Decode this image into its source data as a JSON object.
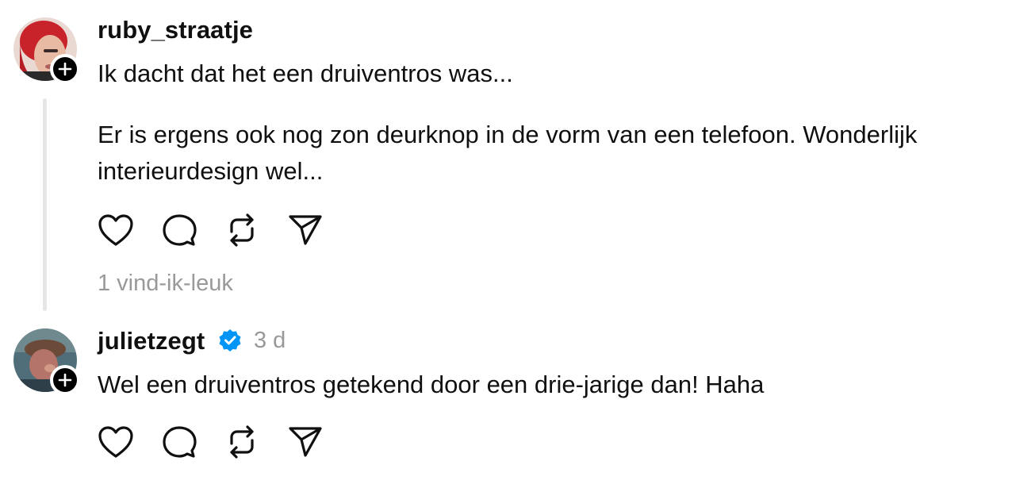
{
  "comments": [
    {
      "username": "ruby_straatje",
      "text_line1": "Ik dacht dat het een druiventros was...",
      "text_line2": "Er is ergens ook nog zon deurknop in de vorm van een telefoon. Wonderlijk",
      "text_line3": "interieurdesign wel...",
      "likes": "1 vind-ik-leuk",
      "avatar_icon": "avatar-red-hair",
      "follow_icon": "plus-icon"
    },
    {
      "username": "julietzegt",
      "verified": true,
      "time": "3 d",
      "text_line1": "Wel een druiventros getekend door een drie-jarige dan! Haha",
      "avatar_icon": "avatar-portrait",
      "follow_icon": "plus-icon"
    }
  ],
  "action_icons": [
    "heart-icon",
    "comment-icon",
    "repost-icon",
    "share-icon"
  ],
  "colors": {
    "text": "#101010",
    "muted": "#999999",
    "thread_line": "#e6e6e6",
    "verified": "#0095f6"
  }
}
